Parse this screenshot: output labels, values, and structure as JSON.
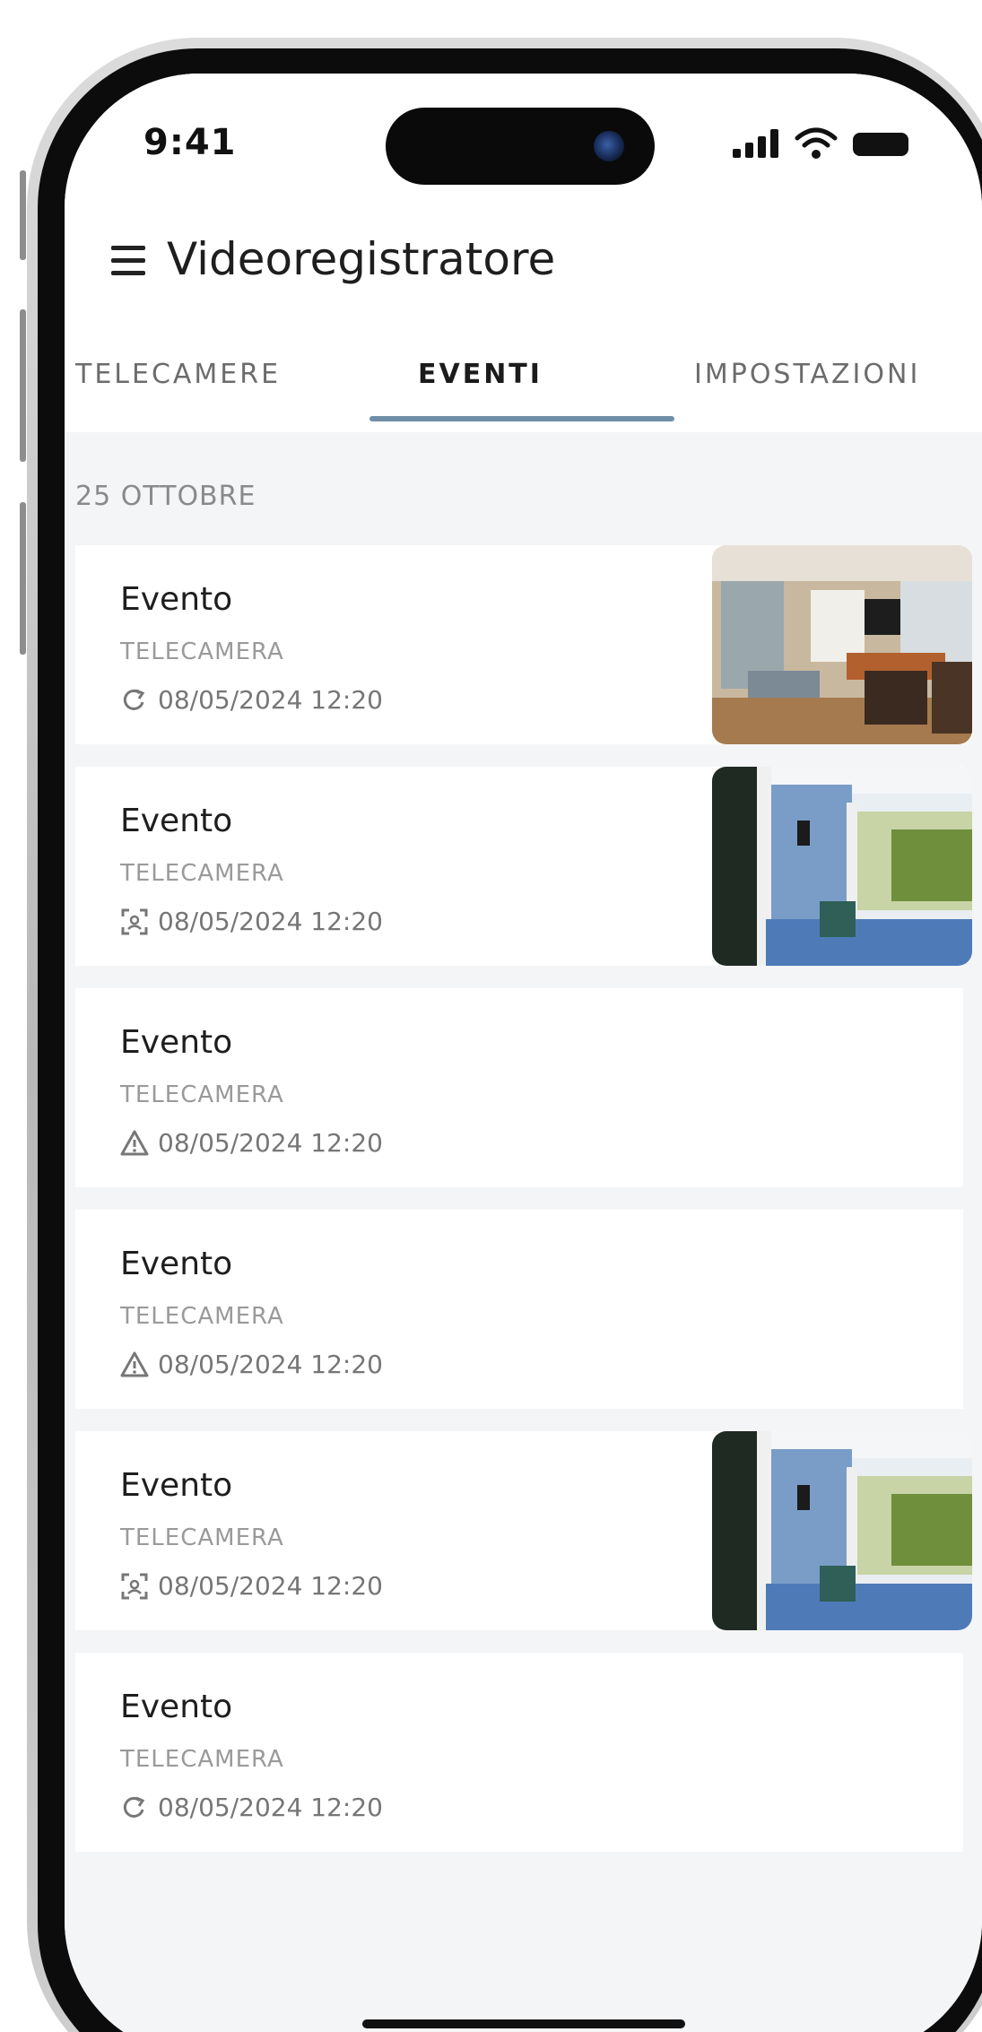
{
  "status_bar": {
    "time": "9:41"
  },
  "app_bar": {
    "title": "Videoregistratore",
    "menu_icon": "hamburger-menu-icon"
  },
  "tabs": [
    {
      "label": "TELECAMERE",
      "active": false
    },
    {
      "label": "EVENTI",
      "active": true
    },
    {
      "label": "IMPOSTAZIONI",
      "active": false
    }
  ],
  "colors": {
    "tab_indicator": "#6f8fa8",
    "background": "#f4f5f6"
  },
  "events_section": {
    "date": "25 OTTOBRE",
    "events": [
      {
        "title": "Evento",
        "camera": "TELECAMERA",
        "timestamp": "08/05/2024 12:20",
        "icon": "motion-rotate-icon",
        "thumbnail": "living-room"
      },
      {
        "title": "Evento",
        "camera": "TELECAMERA",
        "timestamp": "08/05/2024 12:20",
        "icon": "face-detect-icon",
        "thumbnail": "porch"
      },
      {
        "title": "Evento",
        "camera": "TELECAMERA",
        "timestamp": "08/05/2024 12:20",
        "icon": "warning-icon",
        "thumbnail": null
      },
      {
        "title": "Evento",
        "camera": "TELECAMERA",
        "timestamp": "08/05/2024 12:20",
        "icon": "warning-icon",
        "thumbnail": null
      },
      {
        "title": "Evento",
        "camera": "TELECAMERA",
        "timestamp": "08/05/2024 12:20",
        "icon": "face-detect-icon",
        "thumbnail": "porch"
      },
      {
        "title": "Evento",
        "camera": "TELECAMERA",
        "timestamp": "08/05/2024 12:20",
        "icon": "motion-rotate-icon",
        "thumbnail": null
      }
    ]
  }
}
